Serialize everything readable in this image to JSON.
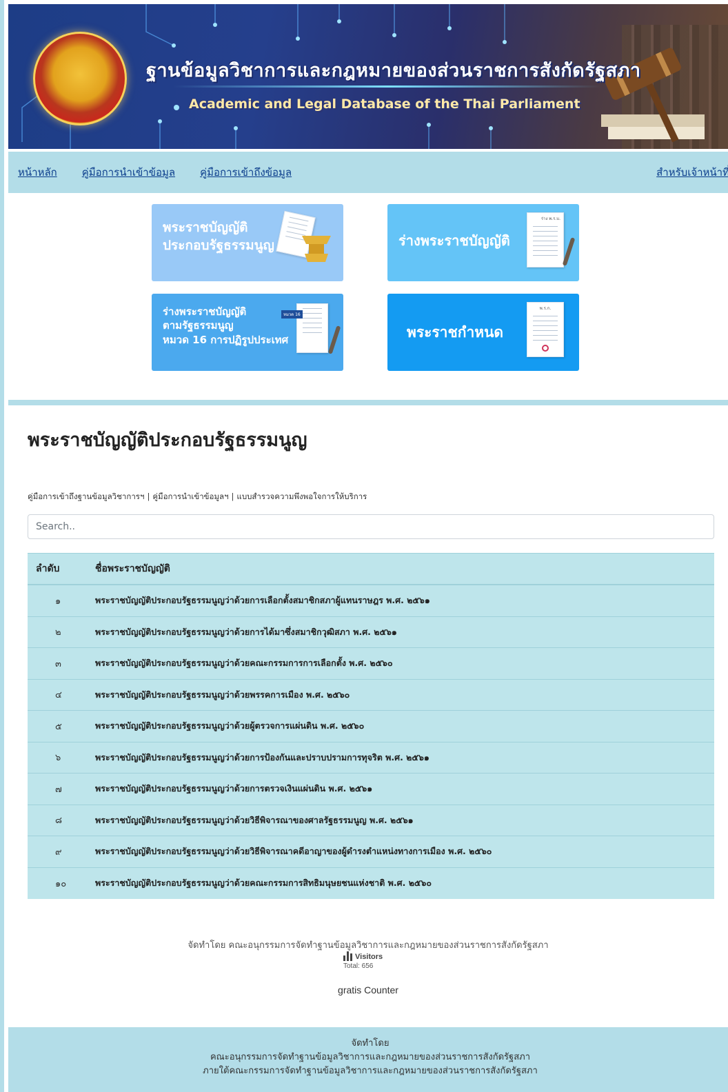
{
  "banner": {
    "title_th": "ฐานข้อมูลวิชาการและกฎหมายของส่วนราชการสังกัดรัฐสภา",
    "title_en": "Academic and Legal Database of the Thai Parliament"
  },
  "nav": {
    "home": "หน้าหลัก",
    "import_guide": "คู่มือการนำเข้าข้อมูล",
    "access_guide": "คู่มือการเข้าถึงข้อมูล",
    "staff": "สำหรับเจ้าหน้าที่"
  },
  "tiles": [
    {
      "label": "พระราชบัญญัติ\nประกอบรัฐธรรมนูญ",
      "color": "#99c9f7"
    },
    {
      "label": "ร่างพระราชบัญญัติ",
      "color": "#64c4f7",
      "doc_tag": "ร่าง พ.ร.บ."
    },
    {
      "label": "ร่างพระราชบัญญัติ\nตามรัฐธรรมนูญ\nหมวด 16 การปฏิรูปประเทศ",
      "color": "#4ba9ee",
      "doc_tag": "หมวด 16"
    },
    {
      "label": "พระราชกำหนด",
      "color": "#149bf2",
      "doc_tag": "พ.ร.ก."
    }
  ],
  "content": {
    "title": "พระราชบัญญัติประกอบรัฐธรรมนูญ",
    "link_access": "คู่มือการเข้าถึงฐานข้อมูลวิชาการฯ",
    "link_import": "คู่มือการนำเข้าข้อมูลฯ",
    "link_survey": "แบบสำรวจความพึงพอใจการให้บริการ",
    "separator": "|",
    "search_placeholder": "Search.."
  },
  "table": {
    "headers": {
      "no": "ลำดับ",
      "name": "ชื่อพระราชบัญญัติ"
    },
    "rows": [
      {
        "no": "๑",
        "name": "พระราชบัญญัติประกอบรัฐธรรมนูญว่าด้วยการเลือกตั้งสมาชิกสภาผู้แทนราษฎร พ.ศ. ๒๕๖๑"
      },
      {
        "no": "๒",
        "name": "พระราชบัญญัติประกอบรัฐธรรมนูญว่าด้วยการได้มาซึ่งสมาชิกวุฒิสภา พ.ศ. ๒๕๖๑"
      },
      {
        "no": "๓",
        "name": "พระราชบัญญัติประกอบรัฐธรรมนูญว่าด้วยคณะกรรมการการเลือกตั้ง พ.ศ. ๒๕๖๐"
      },
      {
        "no": "๔",
        "name": "พระราชบัญญัติประกอบรัฐธรรมนูญว่าด้วยพรรคการเมือง พ.ศ. ๒๕๖๐"
      },
      {
        "no": "๕",
        "name": "พระราชบัญญัติประกอบรัฐธรรมนูญว่าด้วยผู้ตรวจการแผ่นดิน พ.ศ. ๒๕๖๐"
      },
      {
        "no": "๖",
        "name": "พระราชบัญญัติประกอบรัฐธรรมนูญว่าด้วยการป้องกันและปราบปรามการทุจริต พ.ศ. ๒๕๖๑"
      },
      {
        "no": "๗",
        "name": "พระราชบัญญัติประกอบรัฐธรรมนูญว่าด้วยการตรวจเงินแผ่นดิน พ.ศ. ๒๕๖๑"
      },
      {
        "no": "๘",
        "name": "พระราชบัญญัติประกอบรัฐธรรมนูญว่าด้วยวิธีพิจารณาของศาลรัฐธรรมนูญ พ.ศ. ๒๕๖๑"
      },
      {
        "no": "๙",
        "name": "พระราชบัญญัติประกอบรัฐธรรมนูญว่าด้วยวิธีพิจารณาคดีอาญาของผู้ดำรงตำแหน่งทางการเมือง พ.ศ. ๒๕๖๐"
      },
      {
        "no": "๑๐",
        "name": "พระราชบัญญัติประกอบรัฐธรรมนูญว่าด้วยคณะกรรมการสิทธิมนุษยชนแห่งชาติ พ.ศ. ๒๕๖๐"
      }
    ]
  },
  "made_by": "จัดทำโดย คณะอนุกรรมการจัดทำฐานข้อมูลวิชาการและกฎหมายของส่วนราชการสังกัดรัฐสภา",
  "counter": {
    "label": "Visitors",
    "total": "Total: 656",
    "provider": "gratis Counter"
  },
  "footer": {
    "line1": "จัดทำโดย",
    "line2": "คณะอนุกรรมการจัดทำฐานข้อมูลวิชาการและกฎหมายของส่วนราชการสังกัดรัฐสภา",
    "line3": "ภายใต้คณะกรรมการจัดทำฐานข้อมูลวิชาการและกฎหมายของส่วนราชการสังกัดรัฐสภา"
  }
}
